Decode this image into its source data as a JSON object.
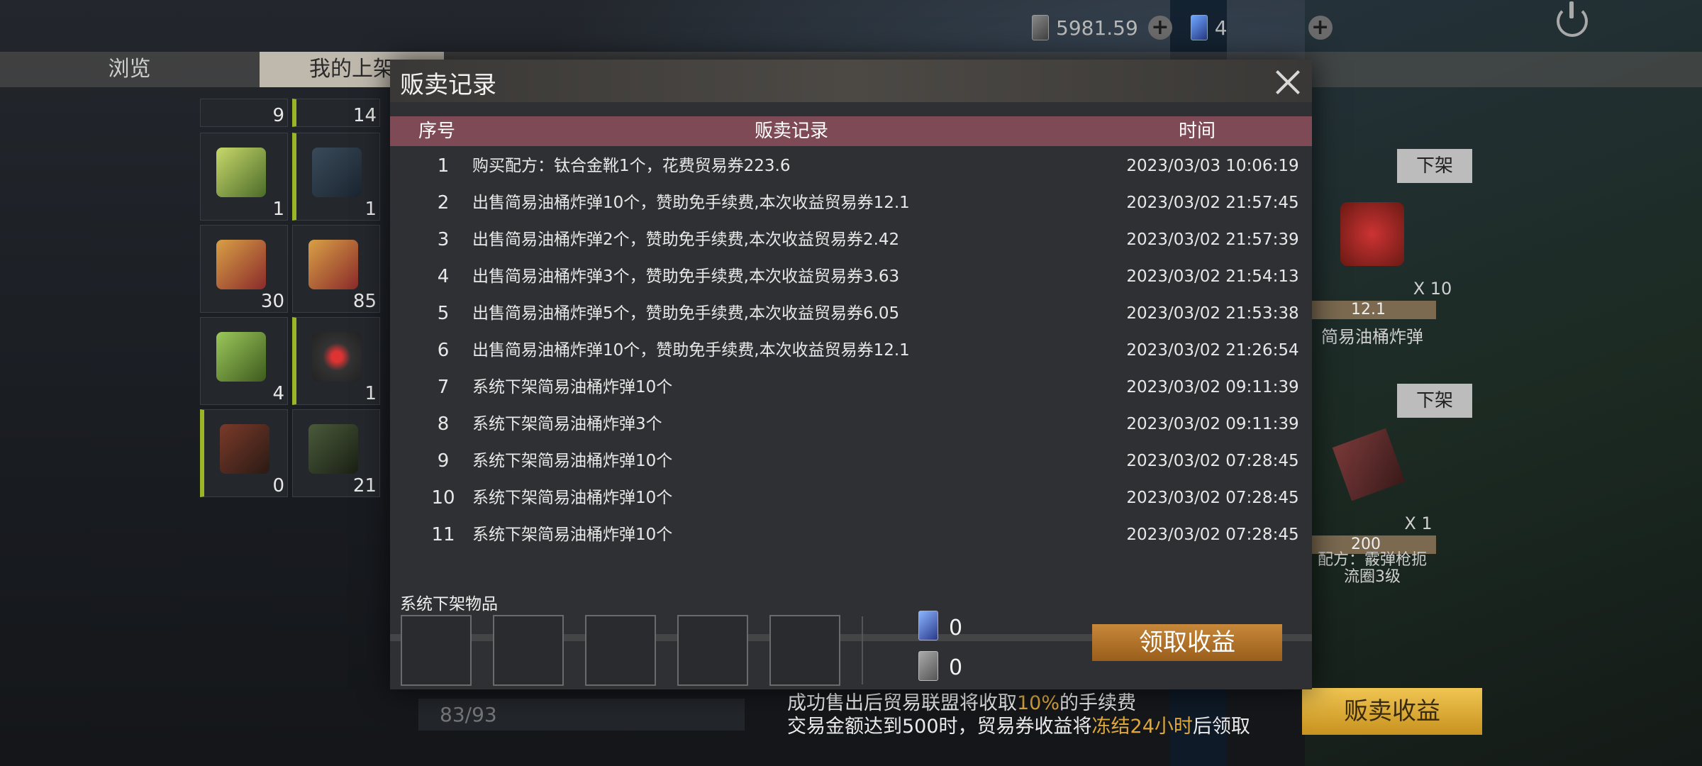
{
  "currency": {
    "trade_coupons": "5981.59",
    "premium_cards": "4",
    "colors": {
      "accent": "#c7883a",
      "gold": "#e0a93c",
      "header_row": "#7d4a55"
    }
  },
  "tabs": [
    "浏览",
    "我的上架"
  ],
  "inventory": {
    "slots": [
      {
        "count": "9",
        "icon": "item-icon"
      },
      {
        "count": "14",
        "icon": "item-icon"
      },
      {
        "count": "1",
        "icon": "syringe-icon"
      },
      {
        "count": "1",
        "icon": "rifle-icon"
      },
      {
        "count": "30",
        "icon": "ammo-icon"
      },
      {
        "count": "85",
        "icon": "ammo-icon"
      },
      {
        "count": "4",
        "icon": "grenade-shell-icon"
      },
      {
        "count": "1",
        "icon": "red-dot-sight-icon"
      },
      {
        "count": "0",
        "icon": "rpg-icon"
      },
      {
        "count": "21",
        "icon": "assault-rifle-icon"
      }
    ],
    "capacity": "83/93"
  },
  "listings": [
    {
      "button": "下架",
      "name": "简易油桶炸弹",
      "qty": "X 10",
      "price": "12.1"
    },
    {
      "button": "下架",
      "name": "配方：霰弹枪扼流圈3级",
      "qty": "X 1",
      "price": "200"
    }
  ],
  "bottom": {
    "notice_line1_pre": "成功售出后贸易联盟将收取",
    "notice_line1_hl": "10%",
    "notice_line1_post": "的手续费",
    "notice_line2_pre": "交易金额达到500时，贸易券收益将",
    "notice_line2_hl": "冻结24小时",
    "notice_line2_post": "后领取",
    "sell_income_button": "贩卖收益"
  },
  "modal": {
    "title": "贩卖记录",
    "headers": {
      "no": "序号",
      "record": "贩卖记录",
      "time": "时间"
    },
    "rows": [
      {
        "no": "1",
        "record": "购买配方：钛合金靴1个，花费贸易券223.6",
        "time": "2023/03/03 10:06:19"
      },
      {
        "no": "2",
        "record": "出售简易油桶炸弹10个，赞助免手续费,本次收益贸易券12.1",
        "time": "2023/03/02 21:57:45"
      },
      {
        "no": "3",
        "record": "出售简易油桶炸弹2个，赞助免手续费,本次收益贸易券2.42",
        "time": "2023/03/02 21:57:39"
      },
      {
        "no": "4",
        "record": "出售简易油桶炸弹3个，赞助免手续费,本次收益贸易券3.63",
        "time": "2023/03/02 21:54:13"
      },
      {
        "no": "5",
        "record": "出售简易油桶炸弹5个，赞助免手续费,本次收益贸易券6.05",
        "time": "2023/03/02 21:53:38"
      },
      {
        "no": "6",
        "record": "出售简易油桶炸弹10个，赞助免手续费,本次收益贸易券12.1",
        "time": "2023/03/02 21:26:54"
      },
      {
        "no": "7",
        "record": "系统下架简易油桶炸弹10个",
        "time": "2023/03/02 09:11:39"
      },
      {
        "no": "8",
        "record": "系统下架简易油桶炸弹3个",
        "time": "2023/03/02 09:11:39"
      },
      {
        "no": "9",
        "record": "系统下架简易油桶炸弹10个",
        "time": "2023/03/02 07:28:45"
      },
      {
        "no": "10",
        "record": "系统下架简易油桶炸弹10个",
        "time": "2023/03/02 07:28:45"
      },
      {
        "no": "11",
        "record": "系统下架简易油桶炸弹10个",
        "time": "2023/03/02 07:28:45"
      }
    ],
    "system_removed_label": "系统下架物品",
    "gain_premium": "0",
    "gain_coupons": "0",
    "claim_button": "领取收益"
  }
}
